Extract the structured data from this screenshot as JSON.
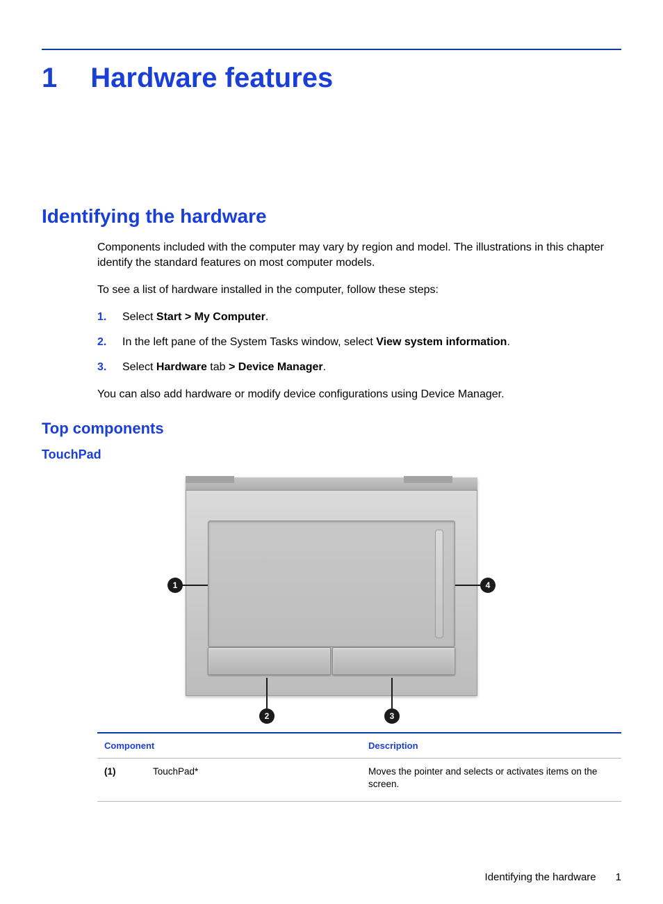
{
  "chapter": {
    "number": "1",
    "title": "Hardware features"
  },
  "section": {
    "title": "Identifying the hardware"
  },
  "paragraphs": {
    "intro": "Components included with the computer may vary by region and model. The illustrations in this chapter identify the standard features on most computer models.",
    "lead_in": "To see a list of hardware installed in the computer, follow these steps:",
    "outro": "You can also add hardware or modify device configurations using Device Manager."
  },
  "steps": [
    {
      "n": "1.",
      "pre": "Select ",
      "bold": "Start > My Computer",
      "post": "."
    },
    {
      "n": "2.",
      "pre": "In the left pane of the System Tasks window, select ",
      "bold": "View system information",
      "post": "."
    },
    {
      "n": "3.",
      "pre": "Select ",
      "bold": "Hardware",
      "mid": " tab ",
      "bold2": "> Device Manager",
      "post": "."
    }
  ],
  "subsection": {
    "title": "Top components"
  },
  "subsubsection": {
    "title": "TouchPad"
  },
  "callouts": {
    "c1": "1",
    "c2": "2",
    "c3": "3",
    "c4": "4"
  },
  "table": {
    "headers": {
      "component": "Component",
      "description": "Description"
    },
    "rows": [
      {
        "id": "(1)",
        "name": "TouchPad*",
        "desc": "Moves the pointer and selects or activates items on the screen."
      }
    ]
  },
  "footer": {
    "section": "Identifying the hardware",
    "page": "1"
  }
}
